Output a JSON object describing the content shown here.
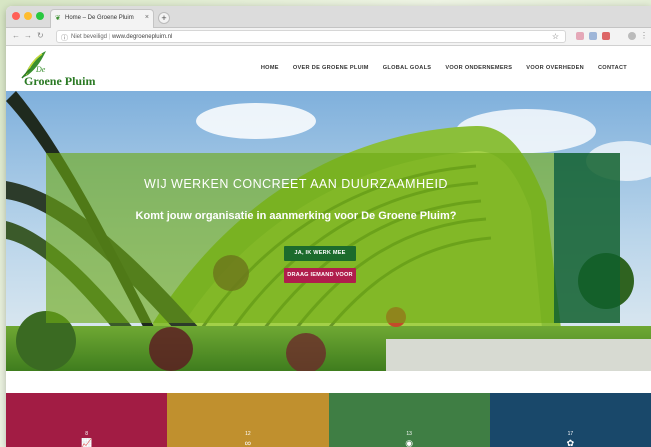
{
  "browser": {
    "tab_title": "Home – De Groene Pluim",
    "tab_close": "×",
    "new_tab": "+",
    "security_label": "Niet beveiligd",
    "url": "www.degroenepluim.nl"
  },
  "site": {
    "logo_de": "De",
    "logo_name": "Groene Pluim",
    "nav": [
      "HOME",
      "OVER DE GROENE PLUIM",
      "GLOBAL GOALS",
      "VOOR ONDERNEMERS",
      "VOOR OVERHEDEN",
      "CONTACT"
    ]
  },
  "hero": {
    "title": "WIJ WERKEN CONCREET AAN DUURZAAMHEID",
    "subtitle": "Komt jouw organisatie in aanmerking voor De Groene Pluim?",
    "button_primary": "JA, IK WERK MEE",
    "button_secondary": "DRAAG IEMAND VOOR"
  },
  "tiles": [
    {
      "number": "8",
      "icon": "growth-chart-icon",
      "color": "#a21c44"
    },
    {
      "number": "12",
      "icon": "infinity-icon",
      "color": "#c0902e"
    },
    {
      "number": "13",
      "icon": "eye-globe-icon",
      "color": "#3f7e44"
    },
    {
      "number": "17",
      "icon": "flower-icon",
      "color": "#19486a"
    }
  ],
  "colors": {
    "brand_green": "#3a8f2f",
    "overlay_green": "#6eaa14",
    "button_green": "#1c6b2c",
    "button_red": "#b01e4c"
  }
}
